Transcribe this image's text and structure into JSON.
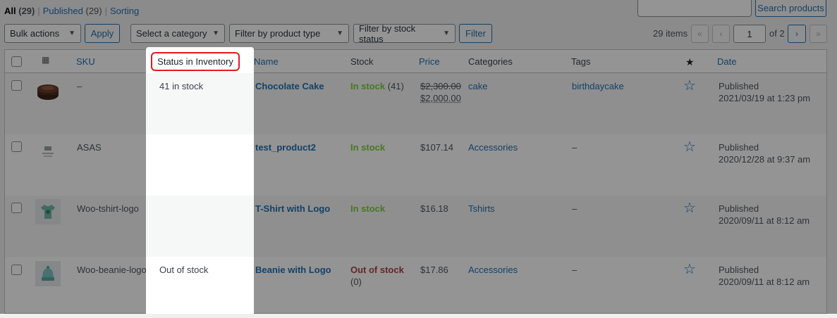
{
  "status_links": [
    {
      "label": "All",
      "count": "(29)"
    },
    {
      "label": "Published",
      "count": "(29)"
    },
    {
      "label": "Sorting",
      "count": ""
    }
  ],
  "search": {
    "button": "Search products",
    "placeholder": ""
  },
  "toolbar": {
    "bulk_actions": "Bulk actions",
    "apply": "Apply",
    "category": "Select a category",
    "product_type": "Filter by product type",
    "stock_status": "Filter by stock status",
    "filter": "Filter"
  },
  "pagination": {
    "items": "29 items",
    "first": "«",
    "prev": "‹",
    "current_page": "1",
    "of_total": "of 2",
    "next": "›",
    "last": "»"
  },
  "columns": {
    "thumb": "image-icon",
    "sku": "SKU",
    "status_inventory": "Status in Inventory",
    "name": "Name",
    "stock": "Stock",
    "price": "Price",
    "categories": "Categories",
    "tags": "Tags",
    "featured": "★",
    "date": "Date"
  },
  "rows": [
    {
      "sku": "–",
      "inventory": "41 in stock",
      "name": "Chocolate Cake",
      "stock_status": "In stock",
      "stock_qty": "(41)",
      "price_regular": "$2,300.00",
      "price_sale": "$2,000.00",
      "category": "cake",
      "tags": "birthdaycake",
      "date_status": "Published",
      "date": "2021/03/19 at 1:23 pm",
      "thumb": "cake-icon"
    },
    {
      "sku": "ASAS",
      "inventory": "",
      "name": "test_product2",
      "stock_status": "In stock",
      "stock_qty": "",
      "price_regular": "",
      "price_sale": "$107.14",
      "category": "Accessories",
      "tags": "–",
      "date_status": "Published",
      "date": "2020/12/28 at 9:37 am",
      "thumb": "placeholder-icon"
    },
    {
      "sku": "Woo-tshirt-logo",
      "inventory": "",
      "name": "T-Shirt with Logo",
      "stock_status": "In stock",
      "stock_qty": "",
      "price_regular": "",
      "price_sale": "$16.18",
      "category": "Tshirts",
      "tags": "–",
      "date_status": "Published",
      "date": "2020/09/11 at 8:12 am",
      "thumb": "tshirt-icon"
    },
    {
      "sku": "Woo-beanie-logo",
      "inventory": "Out of stock",
      "name": "Beanie with Logo",
      "stock_status": "Out of stock",
      "stock_qty": "(0)",
      "price_regular": "",
      "price_sale": "$17.86",
      "category": "Accessories",
      "tags": "–",
      "date_status": "Published",
      "date": "2020/09/11 at 8:12 am",
      "thumb": "beanie-icon"
    }
  ],
  "colors": {
    "link": "#2271b1",
    "in_stock": "#7ad03a",
    "out_of_stock": "#aa4444",
    "highlight_border": "#e11b1b"
  }
}
